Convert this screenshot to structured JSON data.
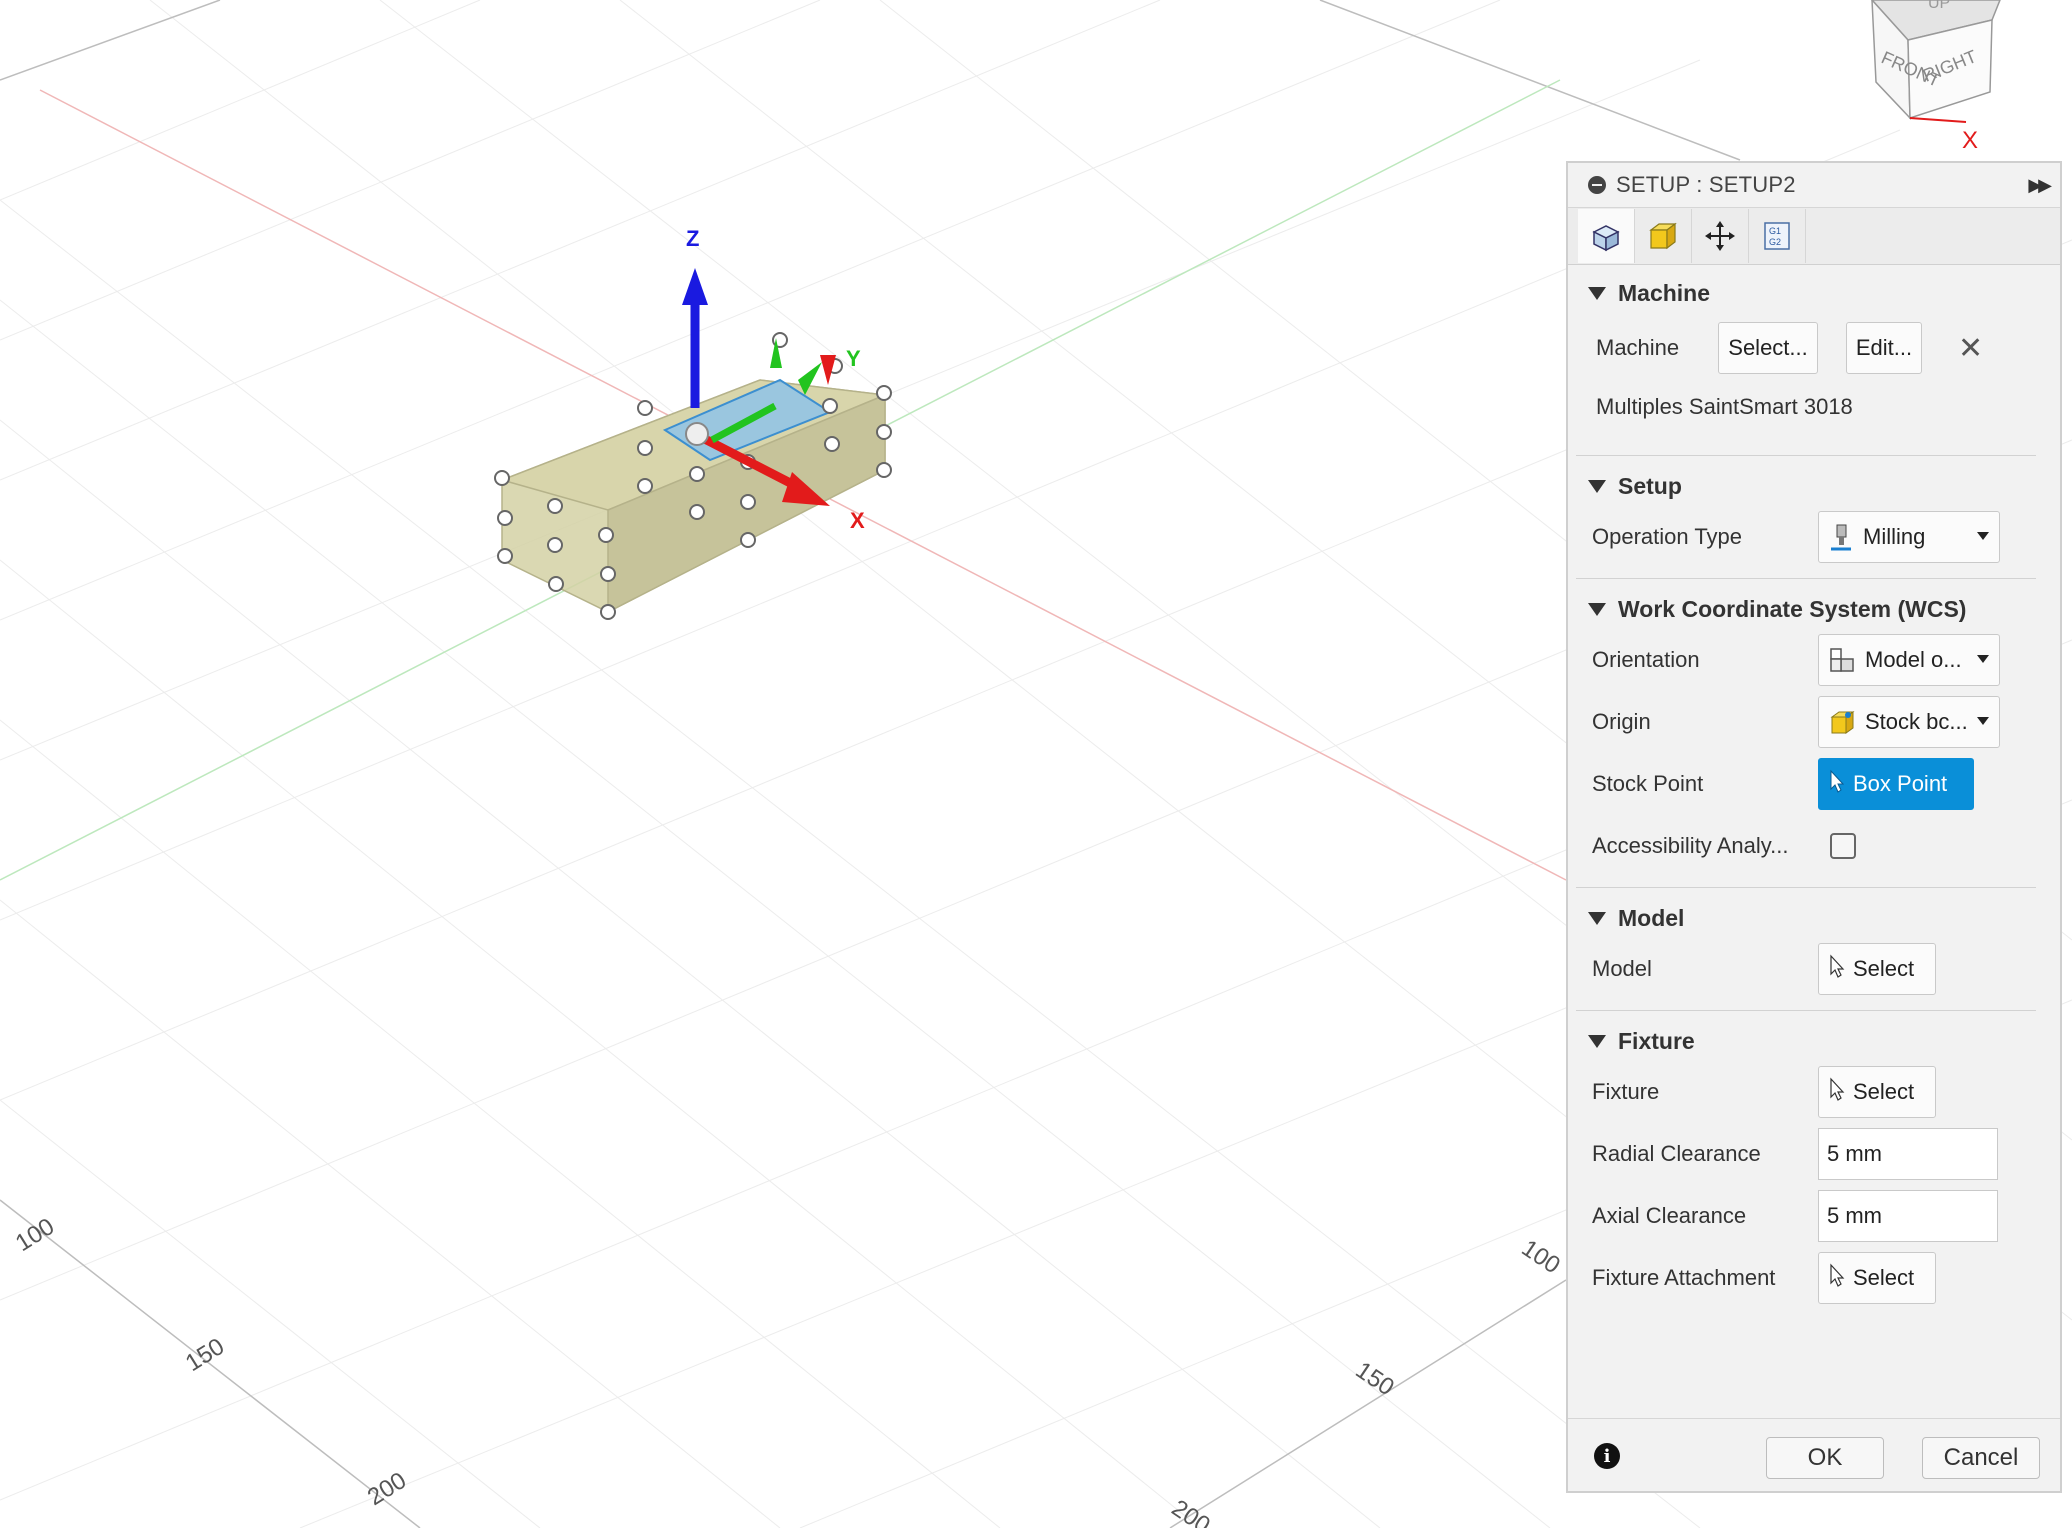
{
  "viewport": {
    "axis_labels": {
      "z": "Z",
      "y": "Y",
      "x": "X"
    },
    "ruler_left": [
      "100",
      "150",
      "200"
    ],
    "ruler_right": [
      "100",
      "150",
      "200"
    ],
    "viewcube": {
      "top": "UP",
      "front": "FRONT",
      "right": "RIGHT",
      "axis": "X"
    }
  },
  "panel": {
    "title": "SETUP : SETUP2",
    "tabs": [
      "setup-tab",
      "stock-tab",
      "post-process-tab",
      "gcode-tab"
    ],
    "machine": {
      "section": "Machine",
      "label": "Machine",
      "select_button": "Select...",
      "edit_button": "Edit...",
      "machine_name": "Multiples SaintSmart 3018"
    },
    "setup": {
      "section": "Setup",
      "operation_type_label": "Operation Type",
      "operation_type_value": "Milling"
    },
    "wcs": {
      "section": "Work Coordinate System (WCS)",
      "orientation_label": "Orientation",
      "orientation_value": "Model o...",
      "origin_label": "Origin",
      "origin_value": "Stock bc...",
      "stock_point_label": "Stock Point",
      "stock_point_value": "Box Point",
      "accessibility_label": "Accessibility Analy..."
    },
    "model": {
      "section": "Model",
      "label": "Model",
      "button": "Select"
    },
    "fixture": {
      "section": "Fixture",
      "label": "Fixture",
      "button": "Select",
      "radial_label": "Radial Clearance",
      "radial_value": "5 mm",
      "axial_label": "Axial Clearance",
      "axial_value": "5 mm",
      "attachment_label": "Fixture Attachment",
      "attachment_button": "Select"
    },
    "footer": {
      "ok": "OK",
      "cancel": "Cancel"
    }
  },
  "colors": {
    "accent": "#0a8fd8",
    "x_axis": "#e21b1b",
    "y_axis": "#22c41f",
    "z_axis": "#1a1ae0"
  }
}
